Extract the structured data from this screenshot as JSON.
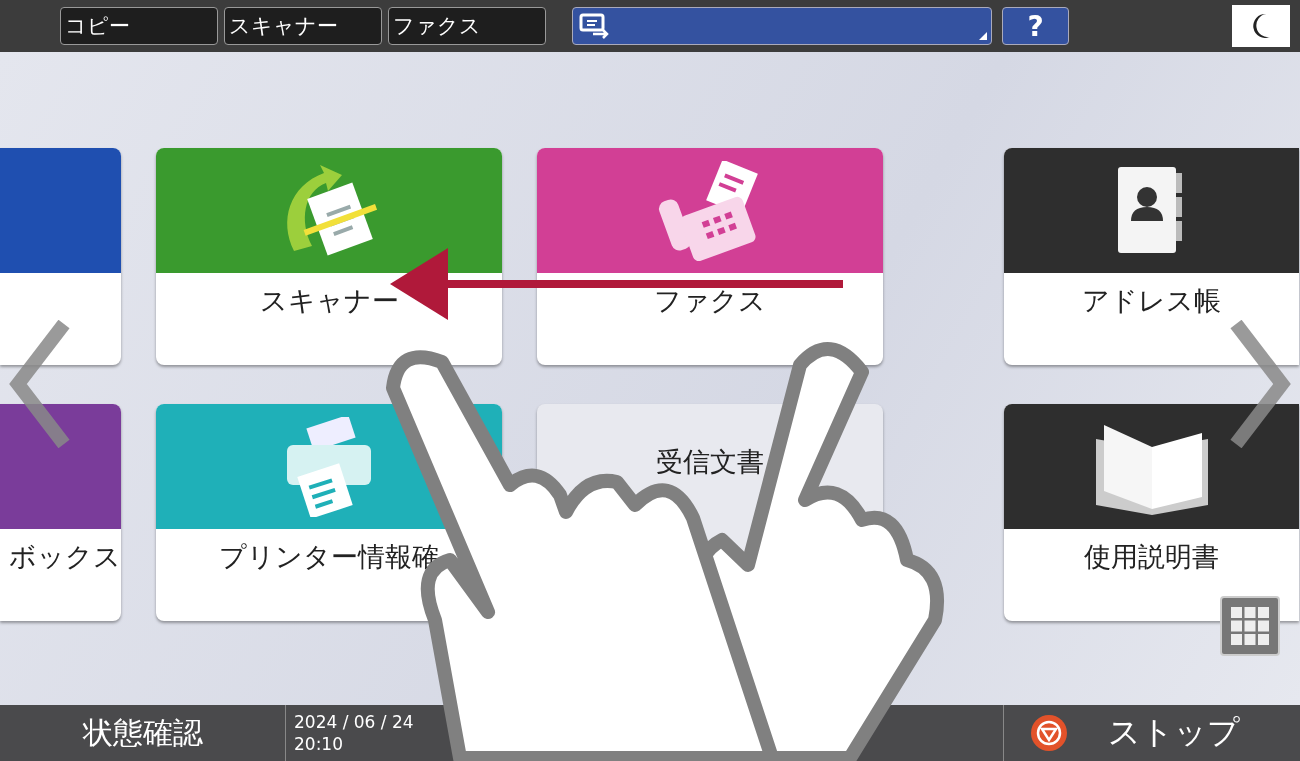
{
  "top_bar": {
    "mode_tabs": [
      {
        "label": "コピー"
      },
      {
        "label": "スキャナー"
      },
      {
        "label": "ファクス"
      }
    ],
    "help_button": {
      "label": "?"
    }
  },
  "tiles": [
    {
      "color": "#1f4fb0",
      "kind": "blank"
    },
    {
      "label": "スキャナー",
      "color": "#3a9a2e",
      "kind": "scanner"
    },
    {
      "label": "ファクス",
      "color": "#d23f95",
      "kind": "fax"
    },
    {
      "label": "アドレス帳",
      "color": "#2e2e2e",
      "kind": "address"
    },
    {
      "label": "ボックス",
      "color": "#7a3c9a",
      "kind": "blank"
    },
    {
      "label": "プリンター情報確",
      "color": "#1fb0b8",
      "kind": "printer"
    },
    {
      "label": "受信文書",
      "color": "#e8e9ef",
      "kind": "plain"
    },
    {
      "label": "使用説明書",
      "color": "#2e2e2e",
      "kind": "manual"
    }
  ],
  "status_bar": {
    "status_button": {
      "label": "状態確認"
    },
    "date": "2024 / 06 / 24",
    "time": "20:10",
    "stop_button": {
      "label": "ストップ"
    }
  }
}
